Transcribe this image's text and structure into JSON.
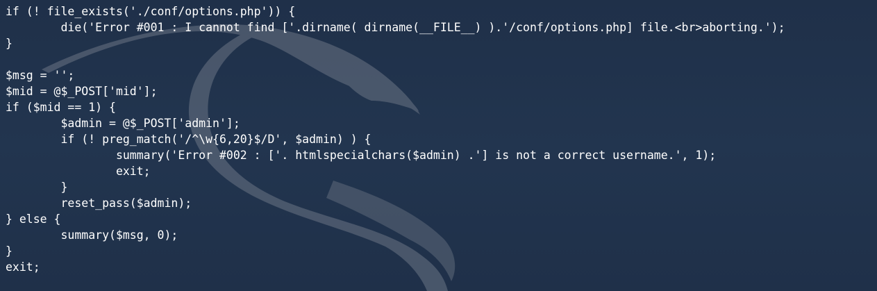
{
  "background": {
    "color": "#1f3049",
    "watermark": "kali-dragon-icon"
  },
  "terminal": {
    "text_color": "#ffffff",
    "lines": [
      "if (! file_exists('./conf/options.php')) {",
      "        die('Error #001 : I cannot find ['.dirname( dirname(__FILE__) ).'/conf/options.php] file.<br>aborting.');",
      "}",
      "",
      "$msg = '';",
      "$mid = @$_POST['mid'];",
      "if ($mid == 1) {",
      "        $admin = @$_POST['admin'];",
      "        if (! preg_match('/^\\w{6,20}$/D', $admin) ) {",
      "                summary('Error #002 : ['. htmlspecialchars($admin) .'] is not a correct username.', 1);",
      "                exit;",
      "        }",
      "        reset_pass($admin);",
      "} else {",
      "        summary($msg, 0);",
      "}",
      "exit;"
    ]
  }
}
